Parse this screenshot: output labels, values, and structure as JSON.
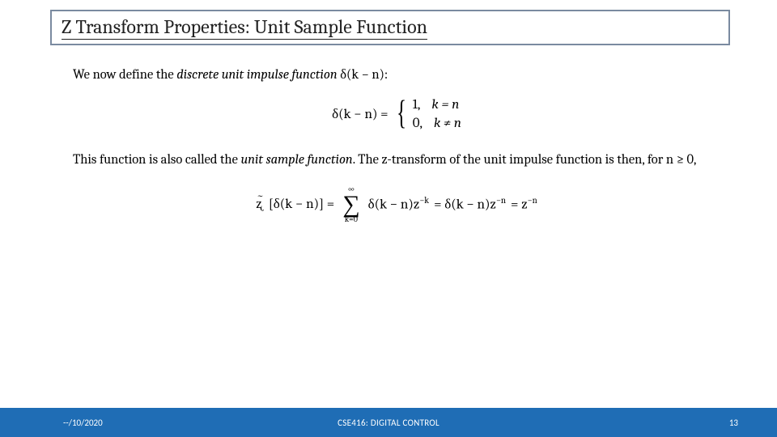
{
  "title": "Z Transform Properties: Unit Sample Function",
  "line1": {
    "prefix": "We now define the ",
    "emph": "discrete unit impulse function",
    "suffix": " δ(k −  n):"
  },
  "eq1": {
    "lhs": "δ(k − n)  = ",
    "case1_val": "1,",
    "case1_cond": "k = n",
    "case2_val": "0,",
    "case2_cond": "k ≠ n"
  },
  "line2": {
    "p1": "This function is also called the ",
    "emph": "unit sample function",
    "p2": ". The z-transform of the unit impulse function is then, for n ≥ 0,"
  },
  "eq2": {
    "z": "ʐ",
    "lbracket": "[δ(k − n)]  = ",
    "sum_top": "∞",
    "sum_sym": "∑",
    "sum_bot": "k=0",
    "term1": "δ(k −  n)z",
    "exp1": "−k",
    "mid": "  =  δ(k − n)z",
    "exp2": "−n",
    "tail": "  =  z",
    "exp3": "−n"
  },
  "footer": {
    "left": "--/10/2020",
    "center": "CSE416: DIGITAL CONTROL",
    "right": "13"
  }
}
